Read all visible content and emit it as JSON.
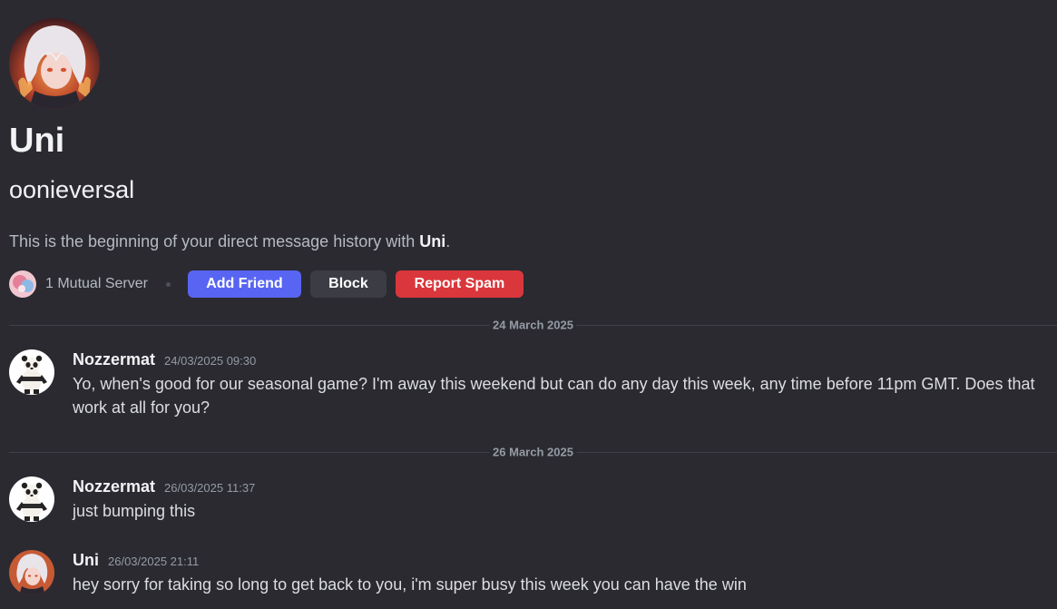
{
  "profile": {
    "display_name": "Uni",
    "username": "oonieversal",
    "intro_prefix": "This is the beginning of your direct message history with ",
    "intro_name": "Uni",
    "intro_suffix": "."
  },
  "actions": {
    "mutual_servers": "1 Mutual Server",
    "add_friend": "Add Friend",
    "block": "Block",
    "report_spam": "Report Spam"
  },
  "dividers": [
    "24 March 2025",
    "26 March 2025"
  ],
  "messages": [
    {
      "author": "Nozzermat",
      "timestamp": "24/03/2025 09:30",
      "text": "Yo, when's good for our seasonal game? I'm away this weekend but can do any day this week, any time before 11pm GMT. Does that work at all for you?"
    },
    {
      "author": "Nozzermat",
      "timestamp": "26/03/2025 11:37",
      "text": "just bumping this"
    },
    {
      "author": "Uni",
      "timestamp": "26/03/2025 21:11",
      "text": "hey sorry for taking so long to get back to you, i'm super busy this week you can have the win"
    }
  ],
  "colors": {
    "background": "#2b2a31",
    "blurple": "#5865f2",
    "danger": "#da373c",
    "secondary": "#3b3c44"
  }
}
